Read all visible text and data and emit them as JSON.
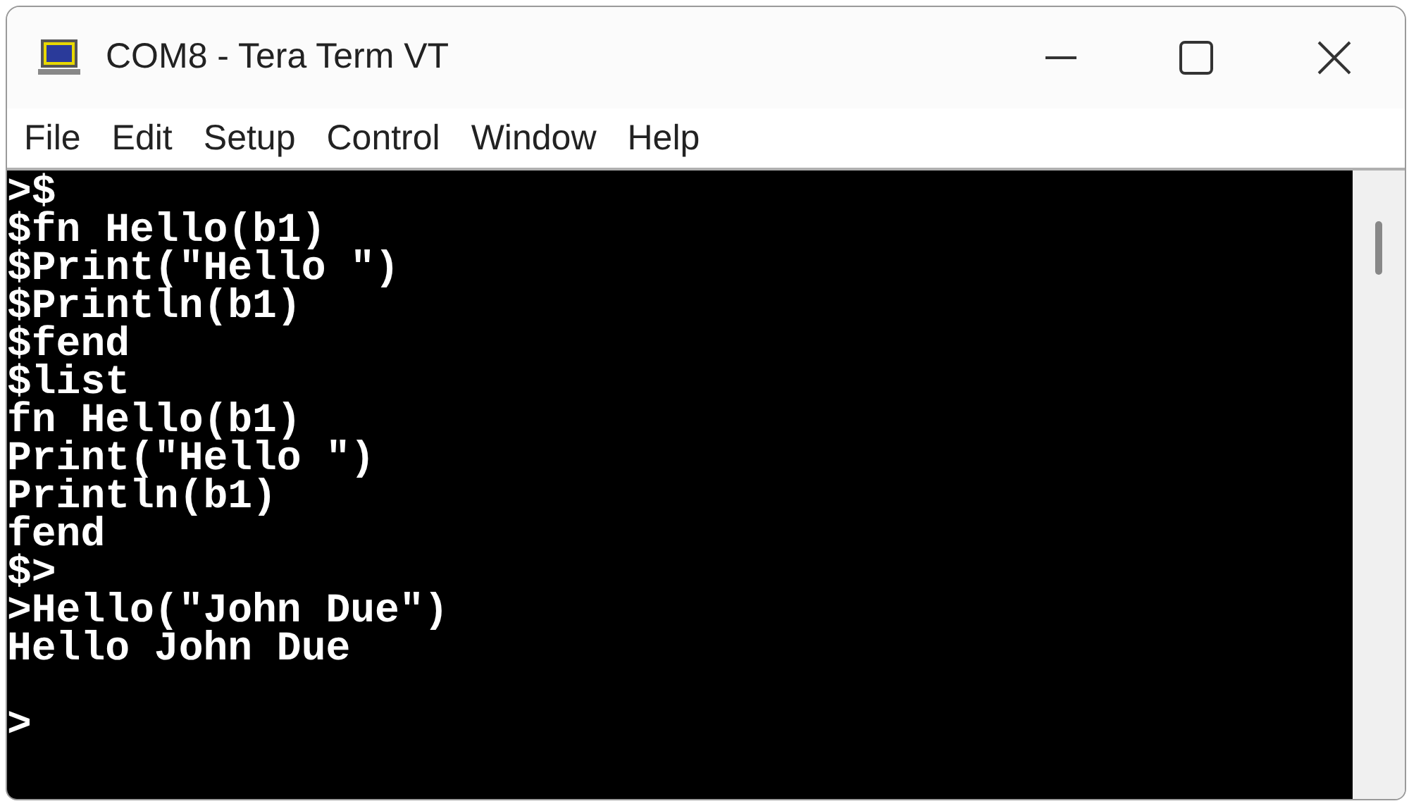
{
  "window": {
    "title": "COM8 - Tera Term VT"
  },
  "menu": [
    "File",
    "Edit",
    "Setup",
    "Control",
    "Window",
    "Help"
  ],
  "terminal": {
    "lines": [
      ">$",
      "$fn Hello(b1)",
      "$Print(\"Hello \")",
      "$Println(b1)",
      "$fend",
      "$list",
      "fn Hello(b1)",
      "Print(\"Hello \")",
      "Println(b1)",
      "fend",
      "$>",
      ">Hello(\"John Due\")",
      "Hello John Due"
    ],
    "prompt": ">"
  }
}
